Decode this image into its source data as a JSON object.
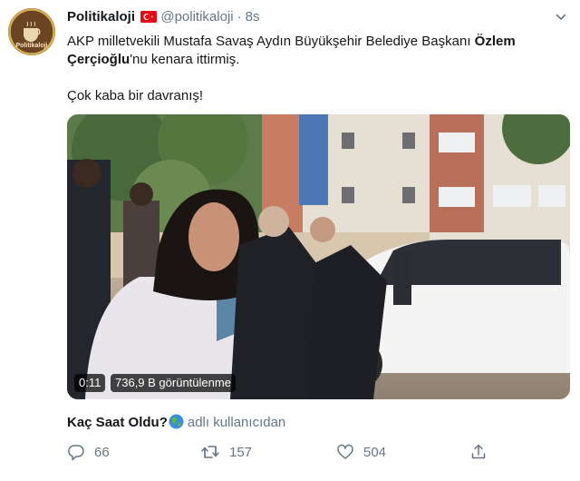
{
  "tweet": {
    "author_name": "Politikaloji",
    "handle": "@politikaloji",
    "separator": "·",
    "time": "8s",
    "avatar_text": "Politikaloji",
    "text_part1": "AKP milletvekili Mustafa Savaş Aydın Büyükşehir Belediye Başkanı ",
    "text_bold": "Özlem Çerçioğlu",
    "text_part2": "'nu kenara ittirmiş.",
    "text_line2": "Çok kaba bir davranış!"
  },
  "video": {
    "duration": "0:11",
    "views": "736,9 B görüntülenme"
  },
  "source": {
    "name": "Kaç Saat Oldu?",
    "suffix": "adlı kullanıcıdan"
  },
  "actions": {
    "replies": "66",
    "retweets": "157",
    "likes": "504"
  },
  "icons": {
    "flag": "turkey-flag-icon",
    "caret": "chevron-down-icon",
    "globe": "globe-icon",
    "reply": "reply-icon",
    "retweet": "retweet-icon",
    "like": "heart-icon",
    "share": "share-icon"
  },
  "colors": {
    "text": "#14171a",
    "muted": "#657786",
    "flag_red": "#e30a17"
  }
}
